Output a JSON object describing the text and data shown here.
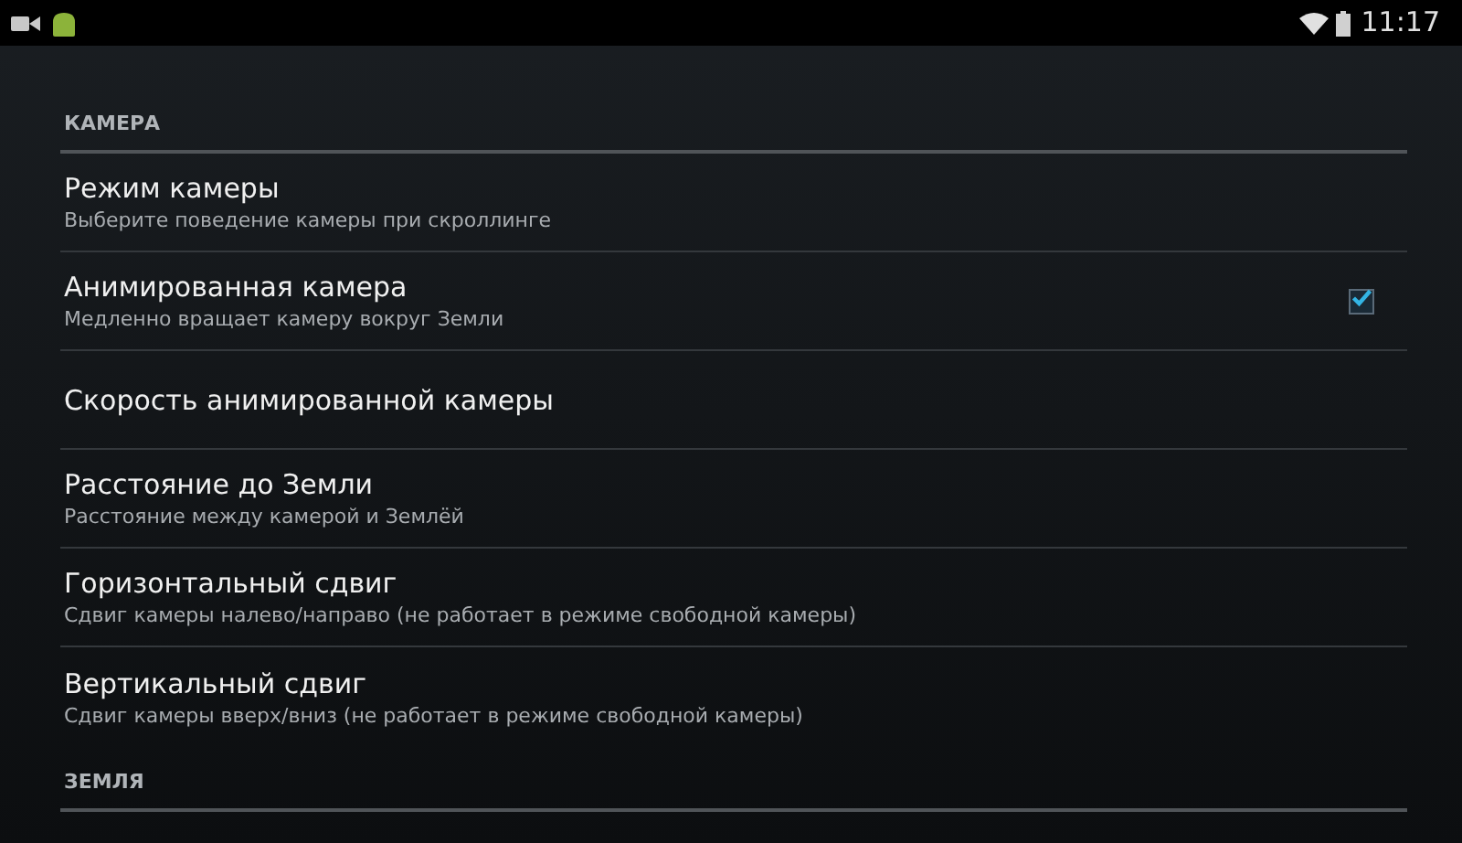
{
  "status_bar": {
    "time": "11:17"
  },
  "sections": [
    {
      "title": "КАМЕРА",
      "items": [
        {
          "kind": "plain",
          "title": "Режим камеры",
          "summary": "Выберите поведение камеры при скроллинге"
        },
        {
          "kind": "checkbox",
          "title": "Анимированная камера",
          "summary": "Медленно вращает камеру вокруг Земли",
          "checked": true
        },
        {
          "kind": "plain",
          "title": "Скорость анимированной камеры"
        },
        {
          "kind": "plain",
          "title": "Расстояние до Земли",
          "summary": "Расстояние между камерой и Землёй"
        },
        {
          "kind": "plain",
          "title": "Горизонтальный сдвиг",
          "summary": "Сдвиг камеры налево/направо (не работает в режиме свободной камеры)"
        },
        {
          "kind": "plain",
          "title": "Вертикальный сдвиг",
          "summary": "Сдвиг камеры вверх/вниз (не работает в режиме свободной камеры)"
        }
      ]
    },
    {
      "title": "ЗЕМЛЯ"
    }
  ]
}
